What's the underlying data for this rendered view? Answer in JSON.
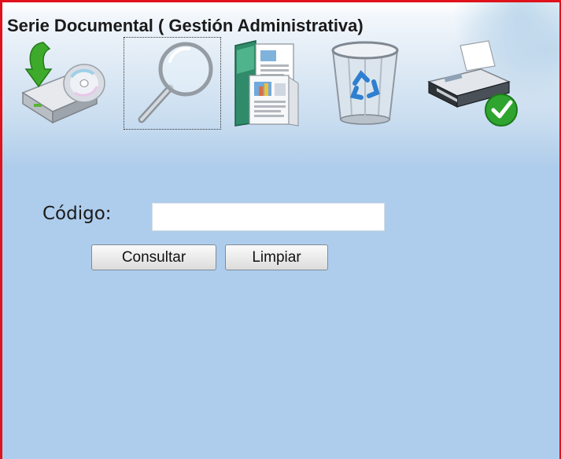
{
  "page": {
    "title": "Serie Documental ( Gestión Administrativa)"
  },
  "toolbar": {
    "tools": [
      {
        "icon": "save-to-disk-icon"
      },
      {
        "icon": "search-magnifier-icon",
        "selected": true
      },
      {
        "icon": "documents-folder-icon"
      },
      {
        "icon": "recycle-bin-icon"
      },
      {
        "icon": "printer-icon"
      }
    ]
  },
  "form": {
    "code_label": "Código:",
    "code_value": "",
    "code_placeholder": "",
    "consult_label": "Consultar",
    "clear_label": "Limpiar"
  },
  "colors": {
    "border": "#e0121b",
    "panel_background": "#aecdec"
  }
}
